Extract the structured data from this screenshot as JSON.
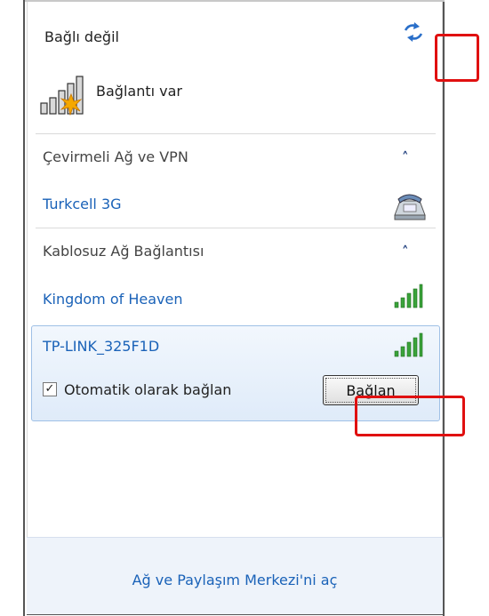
{
  "status": {
    "title": "Bağlı değil",
    "network_label": "Bağlantı var"
  },
  "dialup": {
    "header": "Çevirmeli Ağ ve VPN",
    "item": "Turkcell 3G"
  },
  "wireless": {
    "header": "Kablosuz Ağ Bağlantısı",
    "networks": [
      {
        "name": "Kingdom of Heaven",
        "signal_bars": 5
      },
      {
        "name": "TP-LINK_325F1D",
        "signal_bars": 5
      }
    ],
    "auto_connect_label": "Otomatik olarak bağlan",
    "auto_connect_checked": true,
    "connect_button": "Bağlan"
  },
  "footer": {
    "link": "Ağ ve Paylaşım Merkezi'ni aç"
  },
  "colors": {
    "link": "#1a62b8",
    "highlight_border": "#e01010",
    "selection_bg": "#dfebf9"
  }
}
